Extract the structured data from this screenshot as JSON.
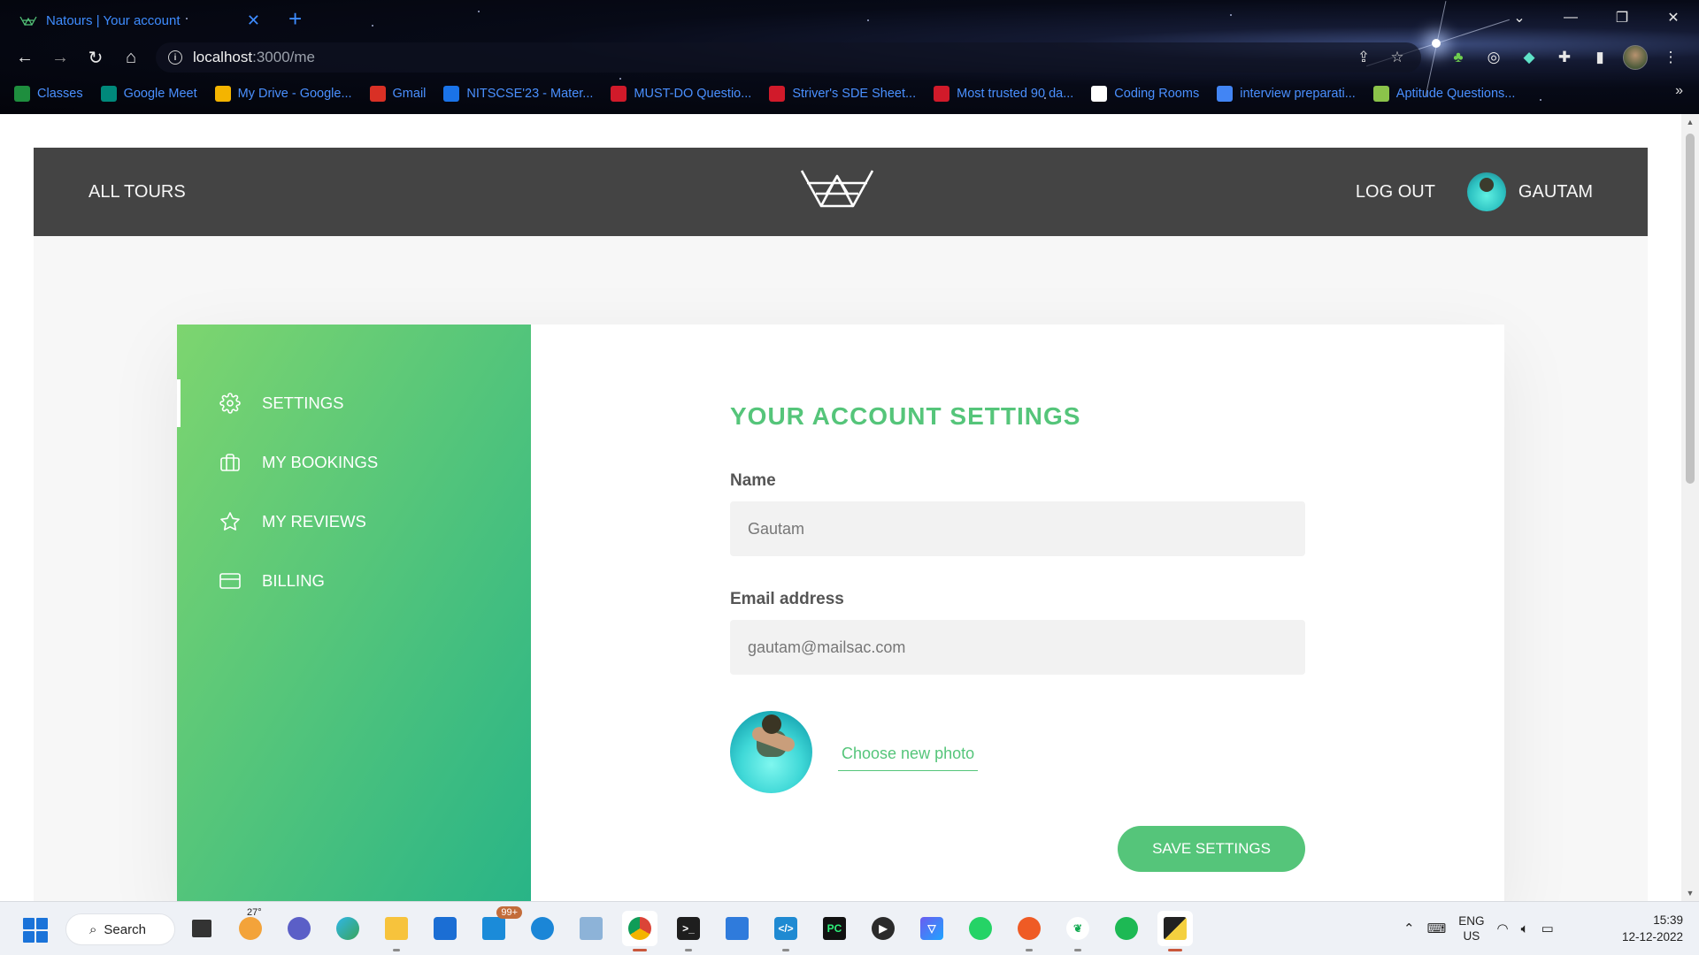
{
  "browser": {
    "tab_title": "Natours | Your account",
    "url_host": "localhost",
    "url_path": ":3000/me",
    "bookmarks": [
      {
        "label": "Classes",
        "icon": "classroom-icon",
        "color": "#1e8e3e"
      },
      {
        "label": "Google Meet",
        "icon": "meet-icon",
        "color": "#00897b"
      },
      {
        "label": "My Drive - Google...",
        "icon": "drive-icon",
        "color": "#f4b400"
      },
      {
        "label": "Gmail",
        "icon": "gmail-icon",
        "color": "#d93025"
      },
      {
        "label": "NITSCSE'23 - Mater...",
        "icon": "classroom-icon",
        "color": "#1a73e8"
      },
      {
        "label": "MUST-DO Questio...",
        "icon": "tuf-icon",
        "color": "#d11a2a"
      },
      {
        "label": "Striver's SDE Sheet...",
        "icon": "tuf-icon",
        "color": "#d11a2a"
      },
      {
        "label": "Most trusted 90 da...",
        "icon": "tuf-icon",
        "color": "#d11a2a"
      },
      {
        "label": "Coding Rooms",
        "icon": "coding-rooms-icon",
        "color": "#ffffff"
      },
      {
        "label": "interview preparati...",
        "icon": "docs-icon",
        "color": "#4285f4"
      },
      {
        "label": "Aptitude Questions...",
        "icon": "leaf-icon",
        "color": "#8bc34a"
      }
    ]
  },
  "header": {
    "all_tours": "All tours",
    "logout": "Log out",
    "user_name": "GAUTAM"
  },
  "side_menu": {
    "items": [
      {
        "label": "Settings",
        "icon": "settings-icon",
        "active": true
      },
      {
        "label": "My bookings",
        "icon": "briefcase-icon",
        "active": false
      },
      {
        "label": "My reviews",
        "icon": "star-icon",
        "active": false
      },
      {
        "label": "Billing",
        "icon": "credit-card-icon",
        "active": false
      }
    ]
  },
  "settings": {
    "title": "Your account settings",
    "name_label": "Name",
    "name_value": "Gautam",
    "email_label": "Email address",
    "email_value": "gautam@mailsac.com",
    "photo_link": "Choose new photo",
    "save_label": "Save settings"
  },
  "taskbar": {
    "search_label": "Search",
    "weather_temp": "27°",
    "mail_badge": "99+",
    "lang_line1": "ENG",
    "lang_line2": "US",
    "time": "15:39",
    "date": "12-12-2022"
  },
  "colors": {
    "accent_green": "#55c57a",
    "gradient_light": "#7dd56f",
    "gradient_dark": "#28b487",
    "header_bg": "#444444"
  }
}
